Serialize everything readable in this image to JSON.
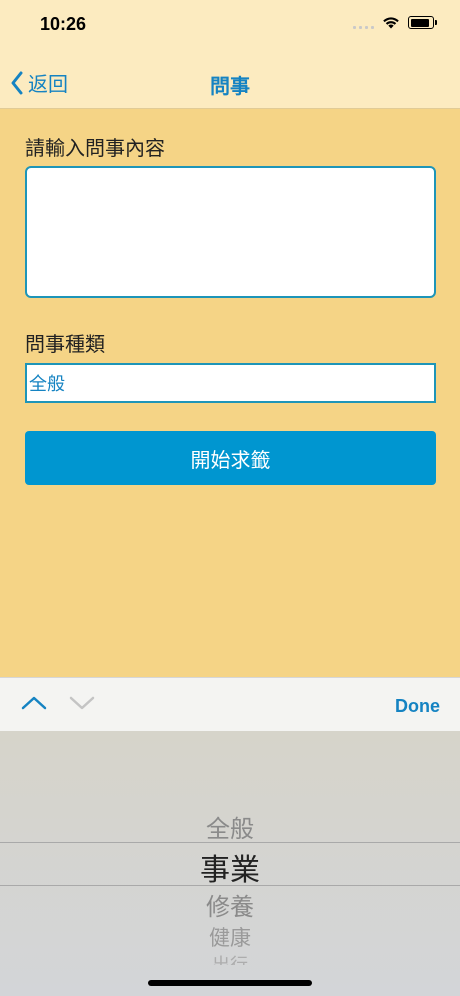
{
  "status": {
    "time": "10:26"
  },
  "nav": {
    "back_label": "返回",
    "title": "問事"
  },
  "form": {
    "content_label": "請輸入問事內容",
    "content_value": "",
    "type_label": "問事種類",
    "type_value": "全般",
    "submit_label": "開始求籤"
  },
  "toolbar": {
    "done_label": "Done"
  },
  "picker": {
    "options": [
      "全般",
      "事業",
      "修養",
      "健康",
      "出行"
    ],
    "selected": "事業"
  },
  "colors": {
    "accent": "#1583C2",
    "button": "#0096D0",
    "background": "#F5D486",
    "navbar": "#FCEBC0"
  }
}
